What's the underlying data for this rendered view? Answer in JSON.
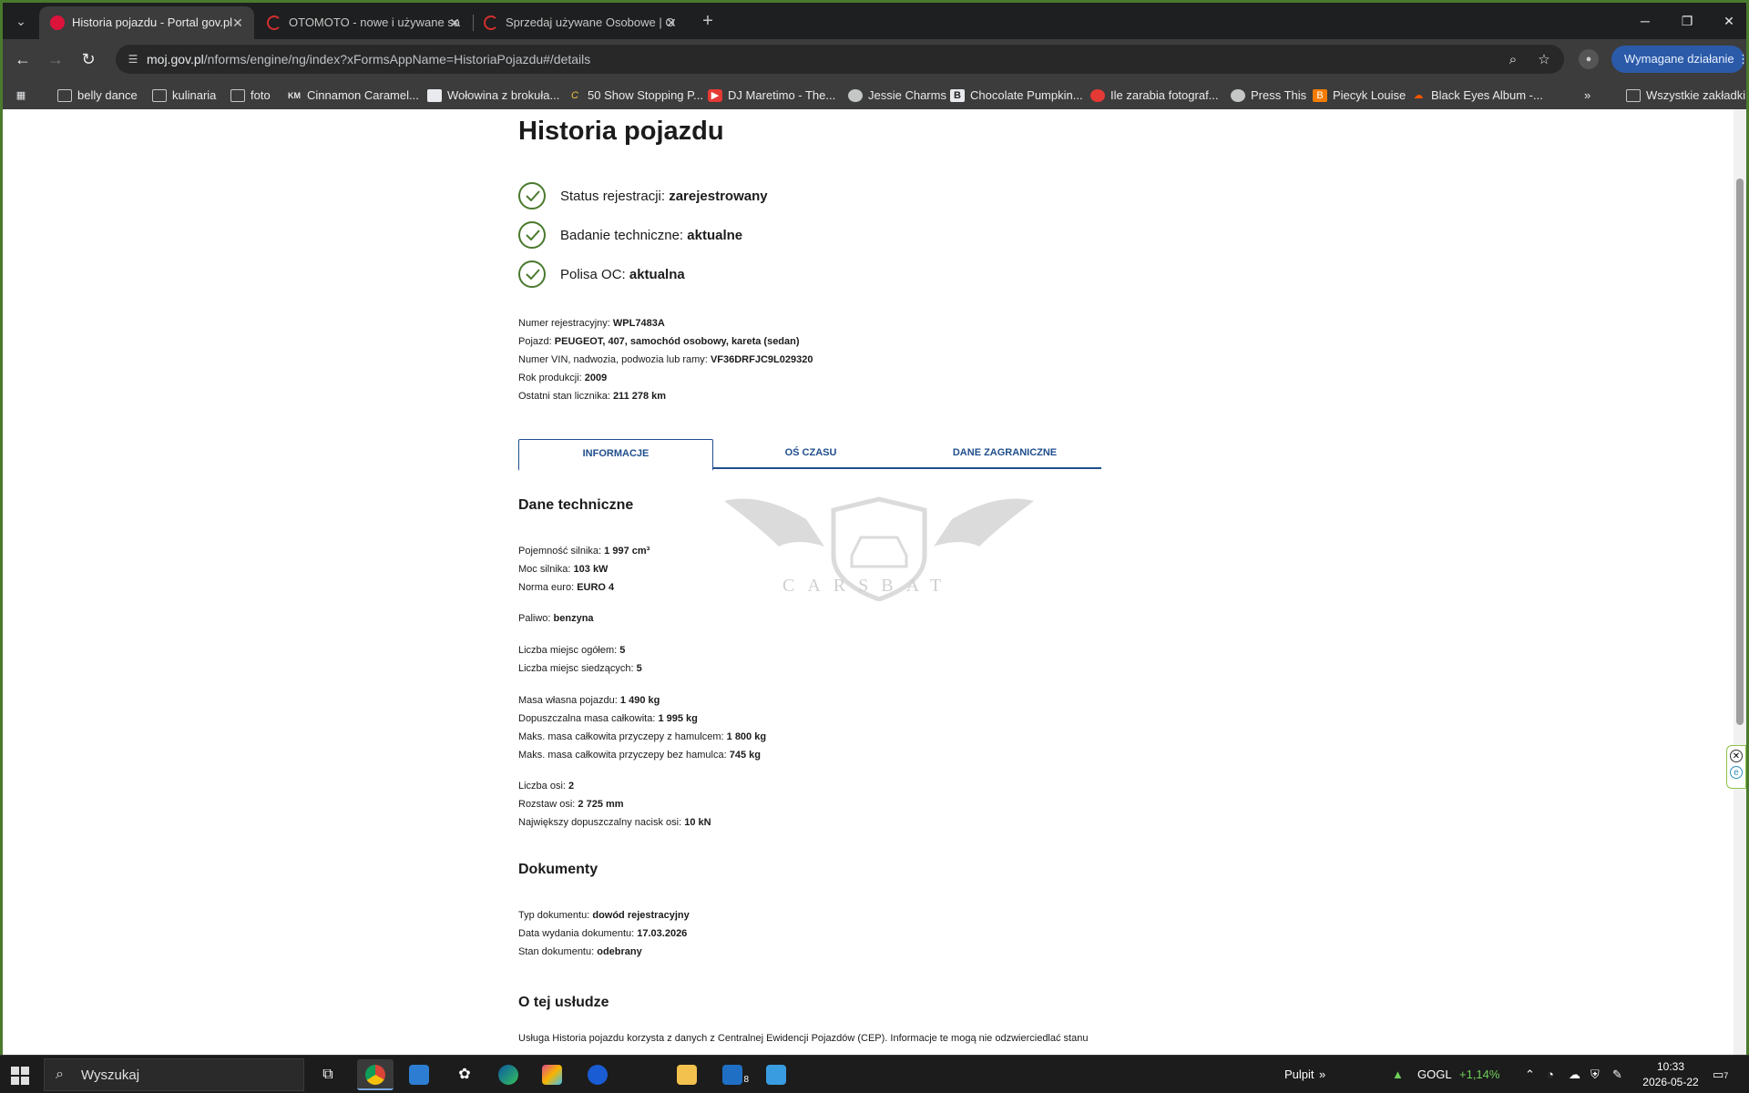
{
  "browser": {
    "tabs": [
      {
        "title": "Historia pojazdu - Portal gov.pl",
        "active": true
      },
      {
        "title": "OTOMOTO - nowe i używane sa",
        "active": false
      },
      {
        "title": "Sprzedaj używane Osobowe | O",
        "active": false
      }
    ],
    "url_host": "moj.gov.pl",
    "url_path": "/nforms/engine/ng/index?xFormsAppName=HistoriaPojazdu#/details",
    "action_button": "Wymagane działanie",
    "bookmarks": [
      {
        "label": "belly dance",
        "icon": "folder-icon"
      },
      {
        "label": "kulinaria",
        "icon": "folder-icon"
      },
      {
        "label": "foto",
        "icon": "folder-icon"
      },
      {
        "label": "Cinnamon Caramel...",
        "icon": "km-icon"
      },
      {
        "label": "Wołowina z brokuła...",
        "icon": "page-icon"
      },
      {
        "label": "50 Show Stopping P...",
        "icon": "c-icon"
      },
      {
        "label": "DJ Maretimo - The...",
        "icon": "youtube-icon"
      },
      {
        "label": "Jessie Charms",
        "icon": "globe-icon"
      },
      {
        "label": "Chocolate Pumpkin...",
        "icon": "b-icon"
      },
      {
        "label": "Ile zarabia fotograf...",
        "icon": "red-icon"
      },
      {
        "label": "Press This",
        "icon": "globe-icon"
      },
      {
        "label": "Piecyk Louise",
        "icon": "blogger-icon"
      },
      {
        "label": "Black Eyes Album -...",
        "icon": "soundcloud-icon"
      }
    ],
    "all_bookmarks": "Wszystkie zakładki",
    "accent_color": "#4a7a2e"
  },
  "page": {
    "title": "Historia pojazdu",
    "statuses": [
      {
        "label": "Status rejestracji:",
        "value": "zarejestrowany"
      },
      {
        "label": "Badanie techniczne:",
        "value": "aktualne"
      },
      {
        "label": "Polisa OC:",
        "value": "aktualna"
      }
    ],
    "summary": [
      {
        "label": "Numer rejestracyjny:",
        "value": "WPL7483A"
      },
      {
        "label": "Pojazd:",
        "value": "PEUGEOT, 407, samochód osobowy, kareta (sedan)"
      },
      {
        "label": "Numer VIN, nadwozia, podwozia lub ramy:",
        "value": "VF36DRFJC9L029320"
      },
      {
        "label": "Rok produkcji:",
        "value": "2009"
      },
      {
        "label": "Ostatni stan licznika:",
        "value": "211 278 km"
      }
    ],
    "tabs": [
      "INFORMACJE",
      "OŚ CZASU",
      "DANE ZAGRANICZNE"
    ],
    "tech_title": "Dane techniczne",
    "tech_groups": [
      [
        {
          "label": "Pojemność silnika:",
          "value": "1 997 cm³"
        },
        {
          "label": "Moc silnika:",
          "value": "103 kW"
        },
        {
          "label": "Norma euro:",
          "value": "EURO 4"
        }
      ],
      [
        {
          "label": "Paliwo:",
          "value": "benzyna"
        }
      ],
      [
        {
          "label": "Liczba miejsc ogółem:",
          "value": "5"
        },
        {
          "label": "Liczba miejsc siedzących:",
          "value": "5"
        }
      ],
      [
        {
          "label": "Masa własna pojazdu:",
          "value": "1 490 kg"
        },
        {
          "label": "Dopuszczalna masa całkowita:",
          "value": "1 995 kg"
        },
        {
          "label": "Maks. masa całkowita przyczepy z hamulcem:",
          "value": "1 800 kg"
        },
        {
          "label": "Maks. masa całkowita przyczepy bez hamulca:",
          "value": "745 kg"
        }
      ],
      [
        {
          "label": "Liczba osi:",
          "value": "2"
        },
        {
          "label": "Rozstaw osi:",
          "value": "2 725 mm"
        },
        {
          "label": "Największy dopuszczalny nacisk osi:",
          "value": "10 kN"
        }
      ]
    ],
    "docs_title": "Dokumenty",
    "docs": [
      {
        "label": "Typ dokumentu:",
        "value": "dowód rejestracyjny"
      },
      {
        "label": "Data wydania dokumentu:",
        "value": "17.03.2026"
      },
      {
        "label": "Stan dokumentu:",
        "value": "odebrany"
      }
    ],
    "about_title": "O tej usłudze",
    "about_text": "Usługa Historia pojazdu korzysta z danych z Centralnej Ewidencji Pojazdów (CEP). Informacje te mogą nie odzwierciedlać stanu",
    "watermark": "CARSBAT"
  },
  "taskbar": {
    "search_placeholder": "Wyszukaj",
    "desktop_label": "Pulpit",
    "stock_symbol": "GOGL",
    "stock_change": "+1,14%",
    "time": "10:33",
    "date": "2026-05-22",
    "badge_mail": "8",
    "badge_notif": "7"
  }
}
